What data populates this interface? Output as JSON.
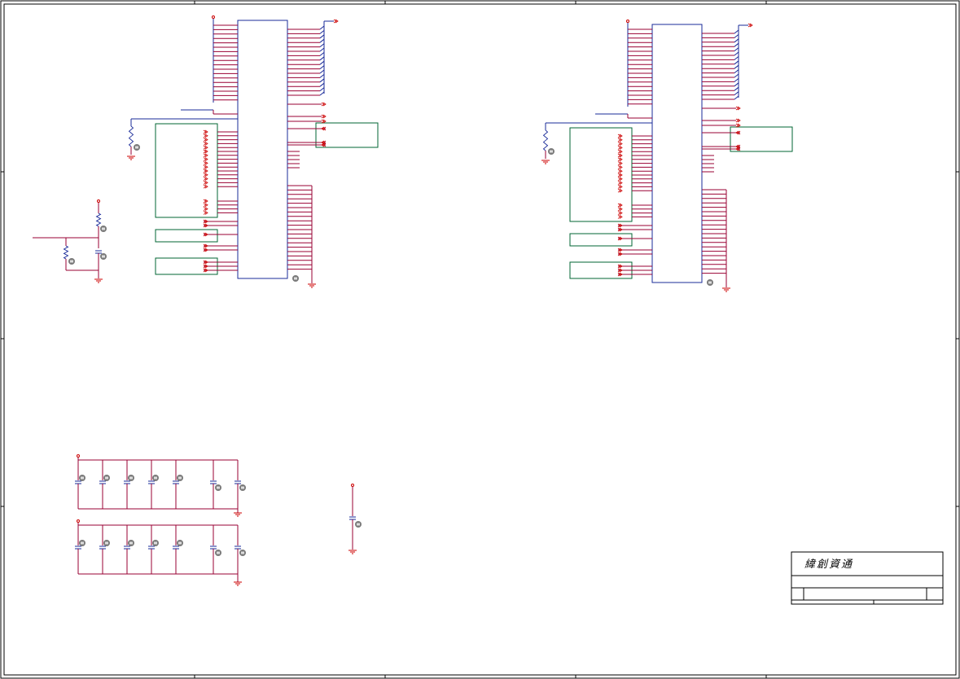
{
  "colors": {
    "wire": "#990033",
    "pin": "#cc0000",
    "chip": "#1a2b99",
    "box": "#006633",
    "frame": "#000000",
    "badge": "#7a7a7a"
  },
  "title_block": {
    "company": "緯創資通"
  }
}
